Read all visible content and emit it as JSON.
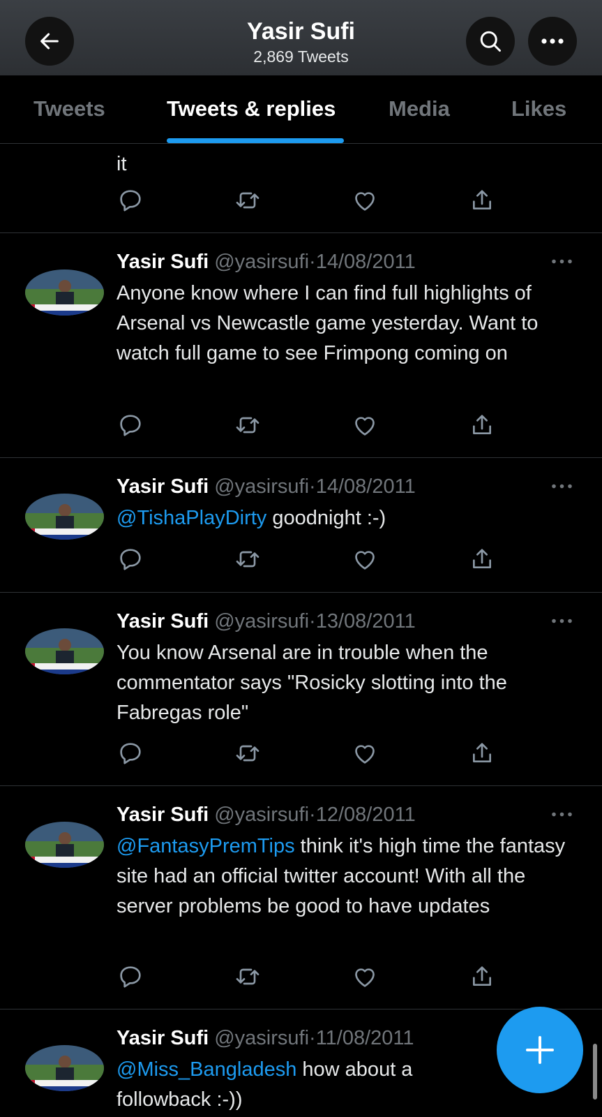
{
  "header": {
    "title": "Yasir Sufi",
    "subtitle": "2,869 Tweets"
  },
  "tabs": [
    {
      "label": "Tweets",
      "active": false
    },
    {
      "label": "Tweets & replies",
      "active": true
    },
    {
      "label": "Media",
      "active": false
    },
    {
      "label": "Likes",
      "active": false
    }
  ],
  "partial_tweet": {
    "text_tail": "it"
  },
  "tweets": [
    {
      "name": "Yasir Sufi",
      "handle": "@yasirsufi",
      "date": "14/08/2011",
      "mention": "",
      "text": "Anyone know where I can find full highlights of Arsenal vs Newcastle game yesterday. Want to watch full game to see Frimpong coming on"
    },
    {
      "name": "Yasir Sufi",
      "handle": "@yasirsufi",
      "date": "14/08/2011",
      "mention": "@TishaPlayDirty",
      "text": "goodnight :-)"
    },
    {
      "name": "Yasir Sufi",
      "handle": "@yasirsufi",
      "date": "13/08/2011",
      "mention": "",
      "text": "You know Arsenal are in trouble when the commentator says \"Rosicky slotting into the Fabregas role\""
    },
    {
      "name": "Yasir Sufi",
      "handle": "@yasirsufi",
      "date": "12/08/2011",
      "mention": "@FantasyPremTips",
      "text": "think it's high time the fantasy site had an official twitter account! With all the server problems be good to have updates"
    },
    {
      "name": "Yasir Sufi",
      "handle": "@yasirsufi",
      "date": "11/08/2011",
      "mention": "@Miss_Bangladesh",
      "text": "how about a followback :-))"
    }
  ],
  "separator": "·",
  "icons": {
    "back": "arrow-left-icon",
    "search": "search-icon",
    "more": "more-horizontal-icon",
    "reply": "reply-icon",
    "retweet": "retweet-icon",
    "like": "heart-icon",
    "share": "share-icon",
    "compose": "plus-icon"
  },
  "colors": {
    "accent": "#1d9bf0",
    "background": "#000000",
    "muted": "#71767b"
  }
}
